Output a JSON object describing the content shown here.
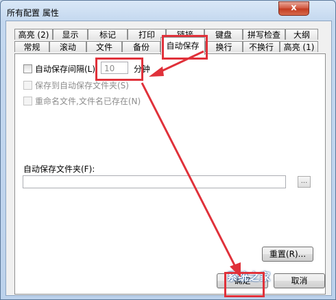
{
  "window": {
    "title": "所有配置 属性",
    "close_glyph": "x"
  },
  "tabs_row_top": [
    {
      "label": "高亮 (2)"
    },
    {
      "label": "显示"
    },
    {
      "label": "标记"
    },
    {
      "label": "打印"
    },
    {
      "label": "链接"
    },
    {
      "label": "键盘"
    },
    {
      "label": "拼写检查"
    },
    {
      "label": "大纲"
    }
  ],
  "tabs_row_bottom": [
    {
      "label": "常规"
    },
    {
      "label": "滚动"
    },
    {
      "label": "文件"
    },
    {
      "label": "备份"
    },
    {
      "label": "自动保存",
      "active": true
    },
    {
      "label": "换行"
    },
    {
      "label": "不换行"
    },
    {
      "label": "高亮 (1)"
    }
  ],
  "autosave": {
    "interval_label": "自动保存间隔(L)",
    "interval_value": "10",
    "interval_unit": "分钟",
    "save_to_folder_label": "保存到自动保存文件夹(S)",
    "rename_label": "重命名文件,文件名已存在(N)",
    "folder_label": "自动保存文件夹(F):",
    "folder_value": "",
    "browse_label": "...",
    "reset_label": "重置(R)..."
  },
  "footer": {
    "ok_label": "确定",
    "cancel_label": "取消"
  },
  "watermark": "系统之家",
  "annotation_color": "#e0313a"
}
